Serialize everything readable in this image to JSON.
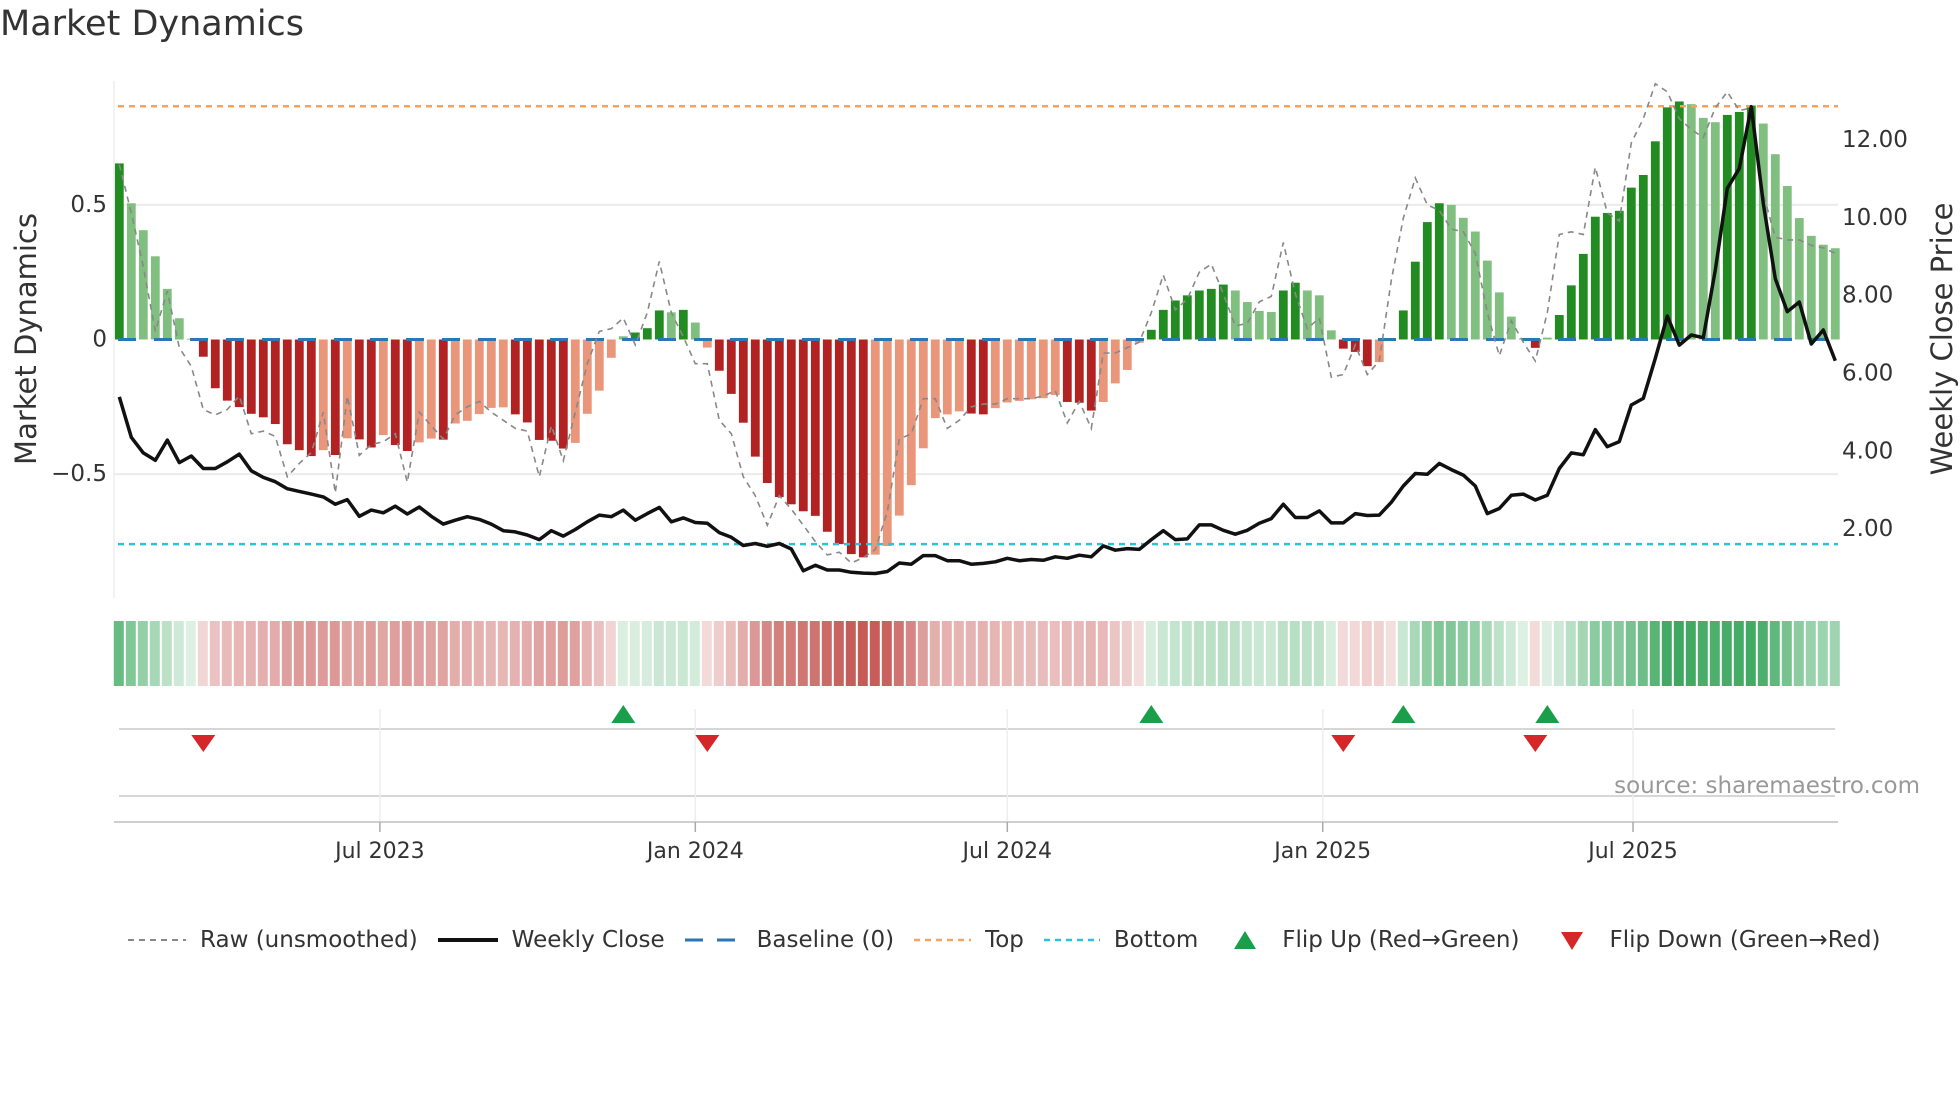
{
  "title": "Market Dynamics",
  "source": "source: sharemaestro.com",
  "legend": {
    "raw": "Raw (unsmoothed)",
    "close": "Weekly Close",
    "baseline": "Baseline (0)",
    "top": "Top",
    "bottom": "Bottom",
    "flip_up": "Flip Up (Red→Green)",
    "flip_down": "Flip Down (Green→Red)"
  },
  "colors": {
    "green_strong": "#228b22",
    "green_weak": "#80bf80",
    "red_strong": "#b22222",
    "red_weak": "#e9967a",
    "raw": "#888888",
    "close": "#111111",
    "baseline": "#2a77b4",
    "top": "#f4a460",
    "bottom": "#29c4dc",
    "flip_up": "#1a9e4a",
    "flip_down": "#d62728",
    "heat_green": "#1e9a46",
    "heat_red": "#b8312d"
  },
  "chart_data": {
    "type": "bar",
    "title": "Market Dynamics",
    "ylabel": "Market Dynamics",
    "y2label": "Weekly Close Price",
    "start_date": "2023-01-30",
    "frequency": "weekly",
    "ylim": [
      -0.96,
      0.96
    ],
    "y2lim": [
      0.23,
      13.52
    ],
    "yticks": [
      {
        "v": 0.5,
        "label": "0.5"
      },
      {
        "v": 0,
        "label": "0"
      },
      {
        "v": -0.5,
        "label": "−0.5"
      }
    ],
    "y2ticks": [
      {
        "v": 12,
        "label": "12.00"
      },
      {
        "v": 10,
        "label": "10.00"
      },
      {
        "v": 8,
        "label": "8.00"
      },
      {
        "v": 6,
        "label": "6.00"
      },
      {
        "v": 4,
        "label": "4.00"
      },
      {
        "v": 2,
        "label": "2.00"
      }
    ],
    "xticks": [
      {
        "date": "2023-07-01",
        "label": "Jul 2023"
      },
      {
        "date": "2024-01-01",
        "label": "Jan 2024"
      },
      {
        "date": "2024-07-01",
        "label": "Jul 2024"
      },
      {
        "date": "2025-01-01",
        "label": "Jan 2025"
      },
      {
        "date": "2025-07-01",
        "label": "Jul 2025"
      }
    ],
    "top": 0.866,
    "bottom": -0.76,
    "baseline": 0,
    "momentum": [
      0.654,
      0.506,
      0.406,
      0.309,
      0.188,
      0.079,
      0.003,
      -0.064,
      -0.181,
      -0.227,
      -0.251,
      -0.276,
      -0.289,
      -0.314,
      -0.389,
      -0.411,
      -0.433,
      -0.411,
      -0.429,
      -0.367,
      -0.371,
      -0.401,
      -0.355,
      -0.392,
      -0.414,
      -0.382,
      -0.368,
      -0.372,
      -0.312,
      -0.302,
      -0.277,
      -0.254,
      -0.252,
      -0.278,
      -0.308,
      -0.373,
      -0.376,
      -0.405,
      -0.384,
      -0.276,
      -0.19,
      -0.068,
      0.012,
      0.026,
      0.042,
      0.108,
      0.101,
      0.11,
      0.063,
      -0.03,
      -0.116,
      -0.202,
      -0.309,
      -0.435,
      -0.533,
      -0.585,
      -0.612,
      -0.638,
      -0.655,
      -0.714,
      -0.76,
      -0.797,
      -0.809,
      -0.799,
      -0.767,
      -0.654,
      -0.541,
      -0.404,
      -0.292,
      -0.278,
      -0.267,
      -0.275,
      -0.278,
      -0.255,
      -0.234,
      -0.228,
      -0.222,
      -0.218,
      -0.206,
      -0.232,
      -0.235,
      -0.264,
      -0.232,
      -0.163,
      -0.113,
      -0.012,
      0.036,
      0.11,
      0.145,
      0.164,
      0.182,
      0.188,
      0.204,
      0.182,
      0.139,
      0.106,
      0.102,
      0.182,
      0.211,
      0.182,
      0.164,
      0.034,
      -0.034,
      -0.046,
      -0.099,
      -0.084,
      -0.005,
      0.108,
      0.289,
      0.436,
      0.506,
      0.5,
      0.452,
      0.401,
      0.293,
      0.175,
      0.085,
      0.004,
      -0.031,
      0.007,
      0.091,
      0.201,
      0.318,
      0.456,
      0.47,
      0.478,
      0.564,
      0.611,
      0.736,
      0.862,
      0.884,
      0.874,
      0.823,
      0.807,
      0.834,
      0.845,
      0.869,
      0.802,
      0.688,
      0.57,
      0.451,
      0.385,
      0.352,
      0.339
    ],
    "raw": [
      0.65,
      0.47,
      0.27,
      0.03,
      0.18,
      -0.03,
      -0.1,
      -0.26,
      -0.28,
      -0.26,
      -0.21,
      -0.35,
      -0.34,
      -0.36,
      -0.51,
      -0.46,
      -0.42,
      -0.27,
      -0.57,
      -0.21,
      -0.43,
      -0.39,
      -0.38,
      -0.35,
      -0.53,
      -0.27,
      -0.32,
      -0.37,
      -0.28,
      -0.25,
      -0.23,
      -0.27,
      -0.3,
      -0.33,
      -0.34,
      -0.51,
      -0.32,
      -0.45,
      -0.27,
      -0.09,
      0.03,
      0.04,
      0.08,
      -0.02,
      0.1,
      0.29,
      0.1,
      0.01,
      -0.09,
      -0.09,
      -0.3,
      -0.35,
      -0.51,
      -0.58,
      -0.69,
      -0.58,
      -0.63,
      -0.69,
      -0.75,
      -0.8,
      -0.79,
      -0.83,
      -0.81,
      -0.78,
      -0.64,
      -0.37,
      -0.35,
      -0.22,
      -0.22,
      -0.33,
      -0.3,
      -0.25,
      -0.24,
      -0.24,
      -0.22,
      -0.22,
      -0.22,
      -0.21,
      -0.19,
      -0.31,
      -0.23,
      -0.33,
      -0.05,
      -0.05,
      -0.03,
      -0.01,
      0.1,
      0.24,
      0.11,
      0.15,
      0.25,
      0.28,
      0.17,
      0.05,
      0.06,
      0.14,
      0.16,
      0.36,
      0.17,
      0.04,
      0.08,
      -0.14,
      -0.13,
      -0.02,
      -0.13,
      -0.08,
      0.22,
      0.45,
      0.6,
      0.5,
      0.48,
      0.41,
      0.4,
      0.32,
      0.1,
      -0.06,
      0.07,
      -0.01,
      -0.08,
      0.1,
      0.39,
      0.4,
      0.39,
      0.64,
      0.47,
      0.44,
      0.73,
      0.82,
      0.95,
      0.92,
      0.82,
      0.78,
      0.75,
      0.86,
      0.92,
      0.85,
      0.86,
      0.54,
      0.38,
      0.37,
      0.37,
      0.35,
      0.34,
      0.32
    ],
    "close": [
      5.4,
      4.36,
      3.96,
      3.77,
      4.29,
      3.71,
      3.88,
      3.56,
      3.56,
      3.73,
      3.93,
      3.5,
      3.33,
      3.22,
      3.04,
      2.97,
      2.9,
      2.83,
      2.64,
      2.76,
      2.33,
      2.49,
      2.42,
      2.59,
      2.39,
      2.57,
      2.33,
      2.13,
      2.23,
      2.32,
      2.25,
      2.13,
      1.96,
      1.93,
      1.85,
      1.73,
      1.96,
      1.82,
      1.99,
      2.19,
      2.36,
      2.32,
      2.49,
      2.23,
      2.4,
      2.56,
      2.19,
      2.29,
      2.17,
      2.15,
      1.91,
      1.79,
      1.58,
      1.63,
      1.56,
      1.63,
      1.49,
      0.93,
      1.07,
      0.95,
      0.95,
      0.89,
      0.87,
      0.86,
      0.91,
      1.13,
      1.1,
      1.32,
      1.32,
      1.19,
      1.19,
      1.1,
      1.12,
      1.16,
      1.25,
      1.19,
      1.22,
      1.2,
      1.29,
      1.25,
      1.33,
      1.29,
      1.57,
      1.46,
      1.5,
      1.48,
      1.73,
      1.96,
      1.73,
      1.75,
      2.11,
      2.11,
      1.97,
      1.87,
      1.97,
      2.15,
      2.27,
      2.64,
      2.3,
      2.3,
      2.47,
      2.16,
      2.16,
      2.4,
      2.35,
      2.36,
      2.69,
      3.11,
      3.43,
      3.41,
      3.69,
      3.53,
      3.39,
      3.11,
      2.4,
      2.53,
      2.87,
      2.9,
      2.75,
      2.87,
      3.56,
      3.96,
      3.91,
      4.56,
      4.12,
      4.25,
      5.19,
      5.36,
      6.39,
      7.48,
      6.73,
      6.99,
      6.92,
      8.66,
      10.76,
      11.27,
      12.86,
      10.37,
      8.44,
      7.59,
      7.84,
      6.76,
      7.12,
      6.33
    ],
    "flips_up": [
      "2023-11-20",
      "2024-09-23",
      "2025-02-17",
      "2025-05-12"
    ],
    "flips_down": [
      "2023-03-20",
      "2024-01-08",
      "2025-01-13",
      "2025-05-05"
    ],
    "grid": true,
    "legend_position": "bottom"
  }
}
